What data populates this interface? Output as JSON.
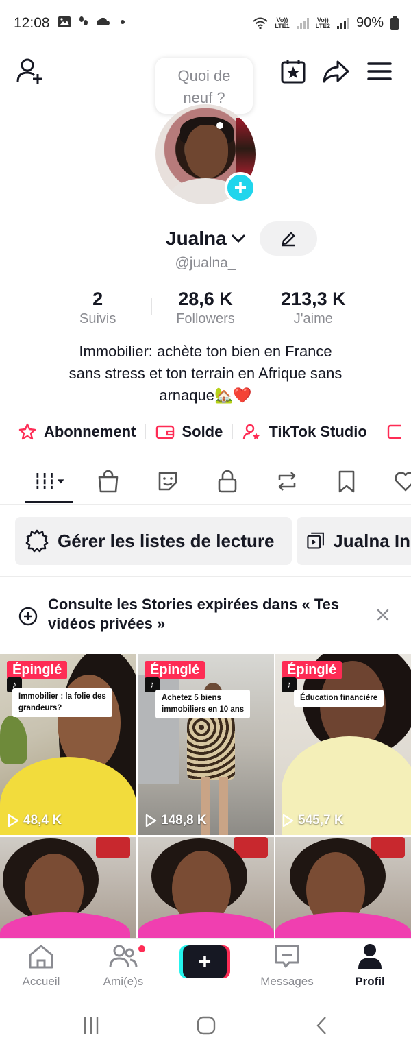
{
  "status_bar": {
    "time": "12:08",
    "lte1": "Vo)) LTE1",
    "lte2": "Vo)) LTE2",
    "battery": "90%"
  },
  "header": {
    "bubble_text_line1": "Quoi de",
    "bubble_text_line2": "neuf ?",
    "icons": [
      "add-friend-icon",
      "calendar-star-icon",
      "share-icon",
      "menu-icon"
    ]
  },
  "profile": {
    "name": "Jualna",
    "handle": "@jualna_",
    "stats": [
      {
        "value": "2",
        "label": "Suivis"
      },
      {
        "value": "28,6 K",
        "label": "Followers"
      },
      {
        "value": "213,3 K",
        "label": "J'aime"
      }
    ],
    "bio_line1": "Immobilier: achète ton bien en France",
    "bio_line2": "sans stress et ton terrain en Afrique sans",
    "bio_line3": "arnaque🏡❤️"
  },
  "links": [
    {
      "label": "Abonnement",
      "icon": "star-ticket-icon"
    },
    {
      "label": "Solde",
      "icon": "wallet-icon"
    },
    {
      "label": "TikTok Studio",
      "icon": "person-star-icon"
    }
  ],
  "tabs": [
    "videos-grid-icon",
    "shop-bag-icon",
    "sticker-icon",
    "lock-icon",
    "repost-icon",
    "bookmark-icon",
    "heart-icon"
  ],
  "playlists": {
    "manage_label": "Gérer les listes de lecture",
    "playlist_label": "Jualna In"
  },
  "stories_banner": {
    "text_line1": "Consulte les Stories expirées dans « Tes",
    "text_line2": "vidéos privées »"
  },
  "videos": [
    {
      "pinned": "Épinglé",
      "caption_line1": "Immobilier : la folie des",
      "caption_line2": "grandeurs?",
      "views": "48,4 K"
    },
    {
      "pinned": "Épinglé",
      "caption_line1": "Achetez 5 biens",
      "caption_line2": "immobiliers en 10 ans",
      "views": "148,8 K"
    },
    {
      "pinned": "Épinglé",
      "caption_line1": "Éducation financière",
      "caption_line2": "",
      "views": "545,7 K"
    }
  ],
  "bottom_nav": [
    {
      "label": "Accueil"
    },
    {
      "label": "Ami(e)s"
    },
    {
      "label": ""
    },
    {
      "label": "Messages"
    },
    {
      "label": "Profil"
    }
  ],
  "colors": {
    "accent_red": "#fe2c55",
    "accent_cyan": "#25f4ee",
    "text_primary": "#161823",
    "text_secondary": "#8a8b91"
  }
}
